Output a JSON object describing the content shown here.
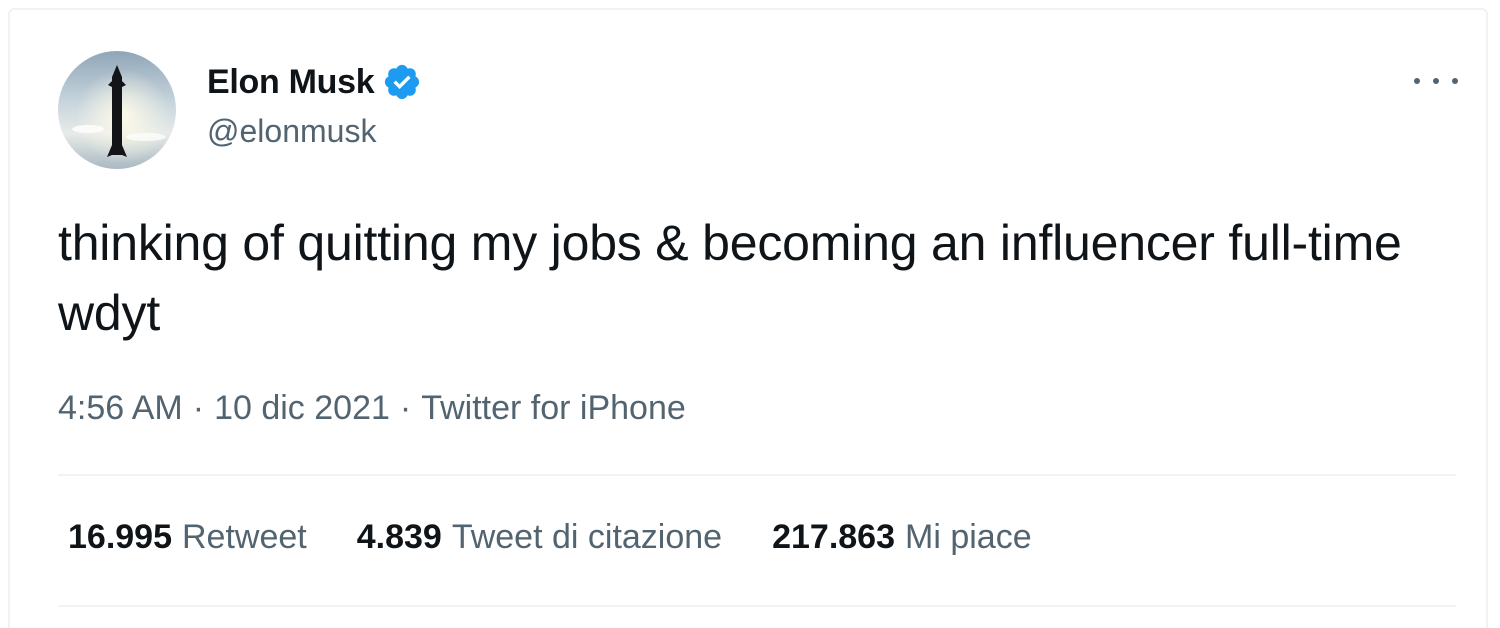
{
  "author": {
    "name": "Elon Musk",
    "handle": "@elonmusk",
    "verified": true,
    "avatar_icon": "starship-avatar"
  },
  "tweet": {
    "text": "thinking of quitting my jobs & becoming an influencer full-time wdyt",
    "time": "4:56 AM",
    "date": "10 dic 2021",
    "source": "Twitter for iPhone",
    "separator": "·"
  },
  "stats": {
    "retweets": {
      "count": "16.995",
      "label": "Retweet"
    },
    "quotes": {
      "count": "4.839",
      "label": "Tweet di citazione"
    },
    "likes": {
      "count": "217.863",
      "label": "Mi piace"
    }
  },
  "icons": {
    "verified": "verified-badge-icon",
    "more": "more-options-icon"
  },
  "colors": {
    "verified_blue": "#1d9bf0",
    "text_primary": "#0f1419",
    "text_secondary": "#536471",
    "divider": "#eff3f4"
  }
}
